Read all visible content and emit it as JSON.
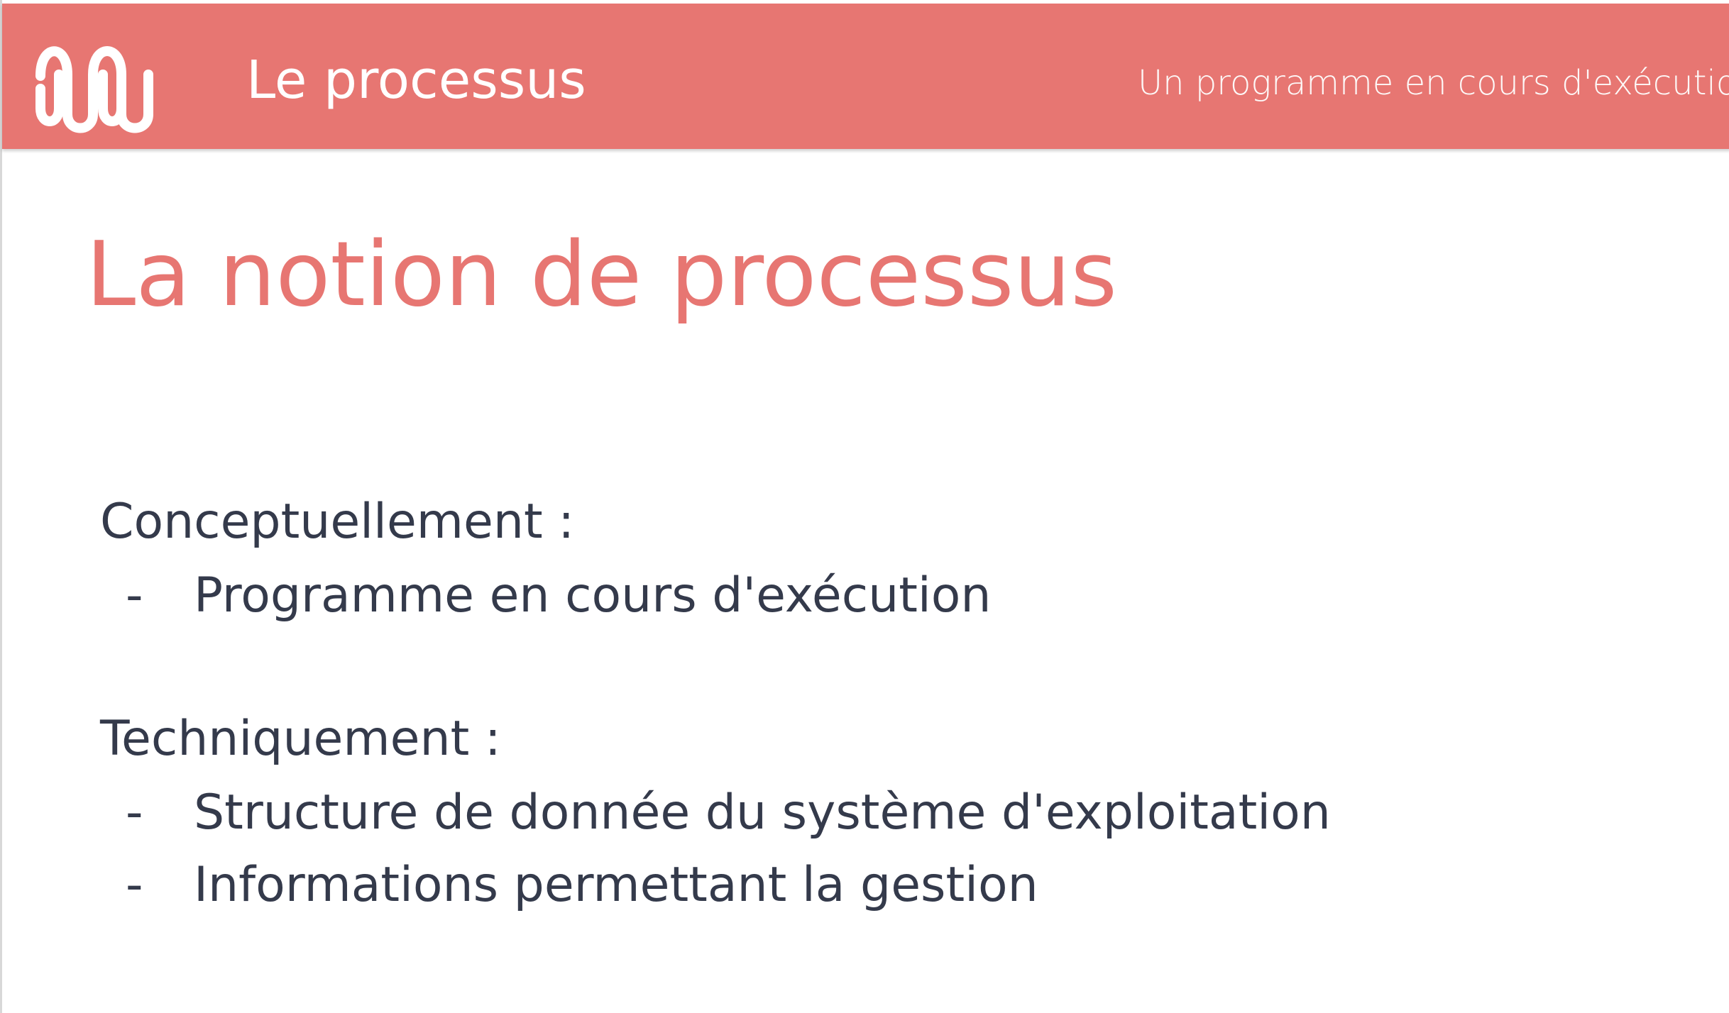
{
  "header": {
    "title": "Le processus",
    "subtitle": "Un programme en cours d'exécution",
    "logo_icon": "wave-logo-icon",
    "background_color": "#e77672"
  },
  "slide": {
    "title": "La notion de processus",
    "title_color": "#e77672",
    "text_color": "#343a4b",
    "sections": [
      {
        "label": "Conceptuellement :",
        "bullets": [
          {
            "dash": "-",
            "text": "Programme en cours d'exécution"
          }
        ]
      },
      {
        "label": "Techniquement :",
        "bullets": [
          {
            "dash": "-",
            "text": "Structure de donnée du système d'exploitation"
          },
          {
            "dash": "-",
            "text": "Informations permettant la gestion"
          }
        ]
      }
    ]
  }
}
